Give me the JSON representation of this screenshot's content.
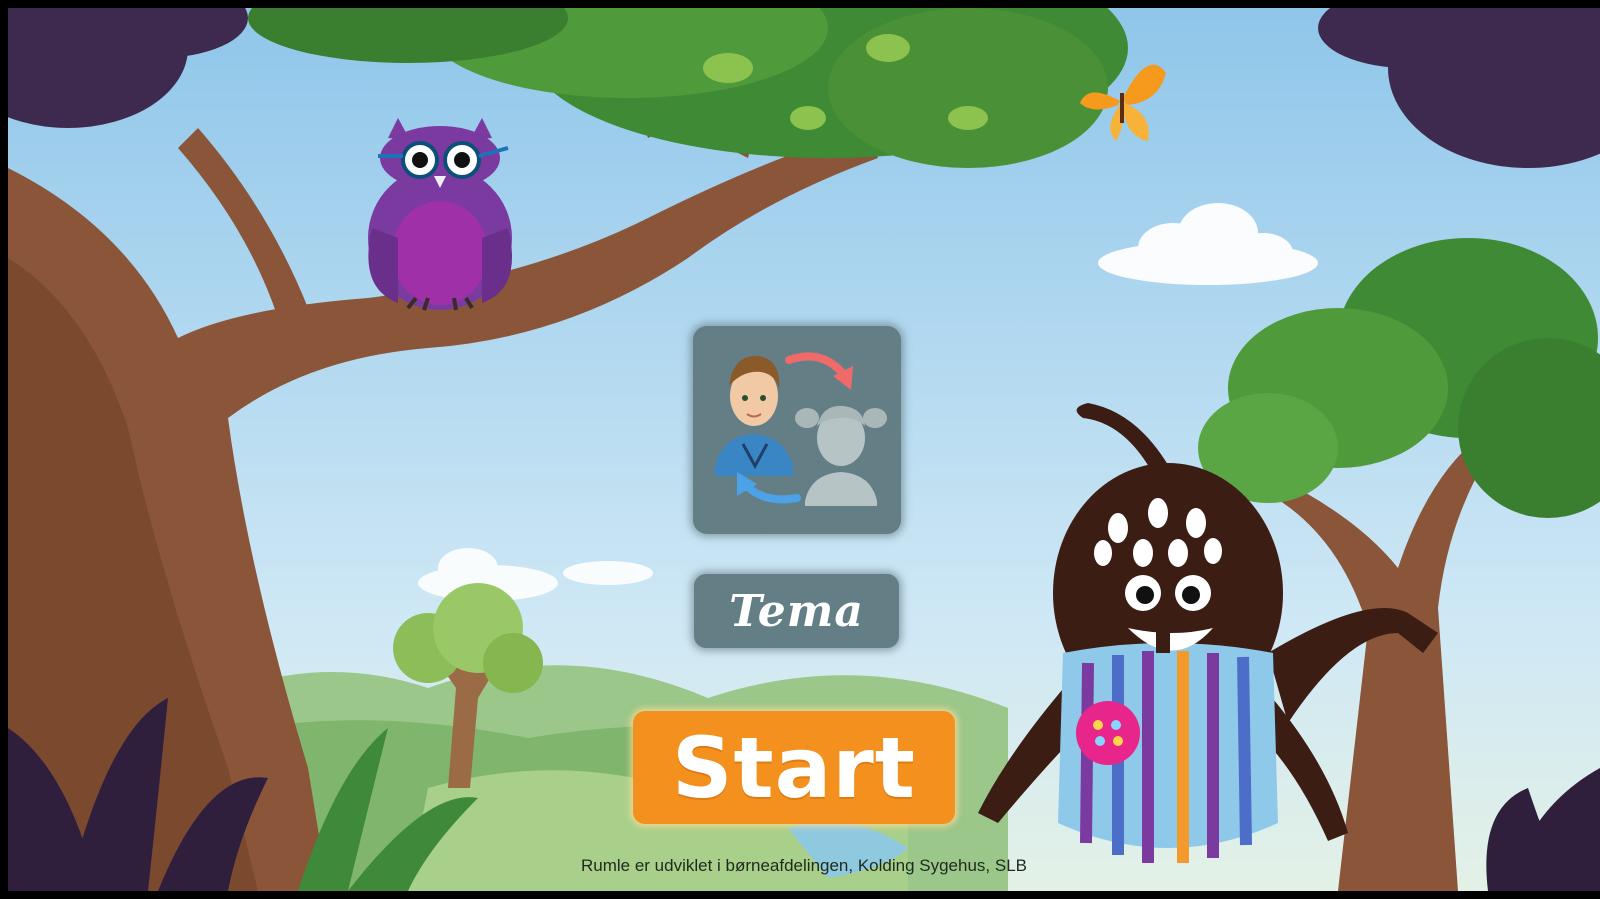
{
  "app": {
    "buttons": {
      "avatar_select": {
        "icon": "switch-avatar-icon"
      },
      "theme_label": "Tema",
      "start_label": "Start"
    },
    "footer_credit": "Rumle er udviklet i børneafdelingen, Kolding Sygehus, SLB"
  },
  "colors": {
    "sky": "#a8d3ee",
    "tree_trunk": "#8a5538",
    "foliage": "#4f9a3a",
    "button_gray": "#647e86",
    "start_orange": "#f4901e",
    "owl_purple": "#7b3aa0",
    "monster_brown": "#3b1d14"
  },
  "characters": [
    "owl",
    "butterfly",
    "monster"
  ]
}
